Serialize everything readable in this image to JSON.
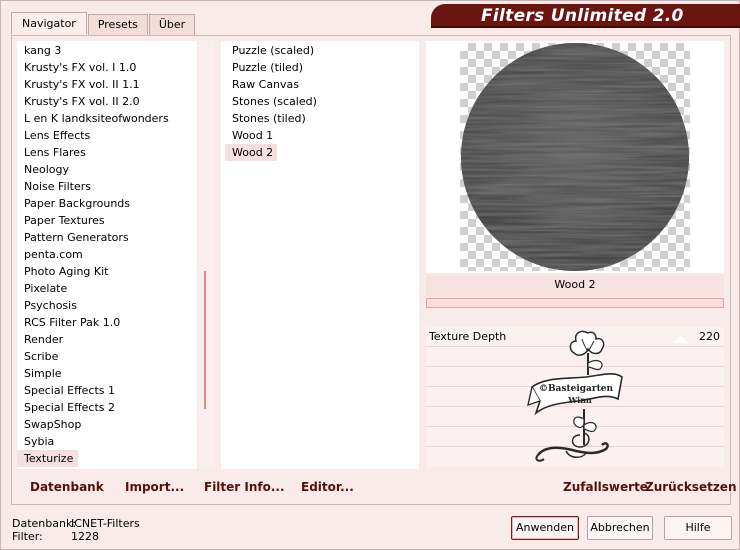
{
  "tabs": [
    {
      "label": "Navigator",
      "active": true
    },
    {
      "label": "Presets",
      "active": false
    },
    {
      "label": "Über",
      "active": false
    }
  ],
  "title": "Filters Unlimited 2.0",
  "categories": [
    "kang 3",
    "Krusty's FX vol. I 1.0",
    "Krusty's FX vol. II 1.1",
    "Krusty's FX vol. II 2.0",
    "L en K landksiteofwonders",
    "Lens Effects",
    "Lens Flares",
    "Neology",
    "Noise Filters",
    "Paper Backgrounds",
    "Paper Textures",
    "Pattern Generators",
    "penta.com",
    "Photo Aging Kit",
    "Pixelate",
    "Psychosis",
    "RCS Filter Pak 1.0",
    "Render",
    "Scribe",
    "Simple",
    "Special Effects 1",
    "Special Effects 2",
    "SwapShop",
    "Sybia",
    "Texturize"
  ],
  "selected_category": "Texturize",
  "filters": [
    "Puzzle (scaled)",
    "Puzzle (tiled)",
    "Raw Canvas",
    "Stones (scaled)",
    "Stones (tiled)",
    "Wood 1",
    "Wood 2"
  ],
  "selected_filter": "Wood 2",
  "preview": {
    "filter_name": "Wood 2",
    "progress": 0
  },
  "params": [
    {
      "label": "Texture Depth",
      "value": "220"
    }
  ],
  "watermark": {
    "line1": "©Basteigarten",
    "line2": "Winn"
  },
  "actions": {
    "datenbank": "Datenbank",
    "import": "Import...",
    "filter_info": "Filter Info...",
    "editor": "Editor...",
    "random": "Zufallswerte",
    "reset": "Zurücksetzen"
  },
  "status": {
    "db_label": "Datenbank:",
    "db_value": "ICNET-Filters",
    "filter_label": "Filter:",
    "filter_value": "1228"
  },
  "buttons": {
    "apply": "Anwenden",
    "cancel": "Abbrechen",
    "help": "Hilfe"
  },
  "colors": {
    "banner": "#6b1510",
    "background": "#f9ebea",
    "accent_text": "#5a0e0a"
  }
}
